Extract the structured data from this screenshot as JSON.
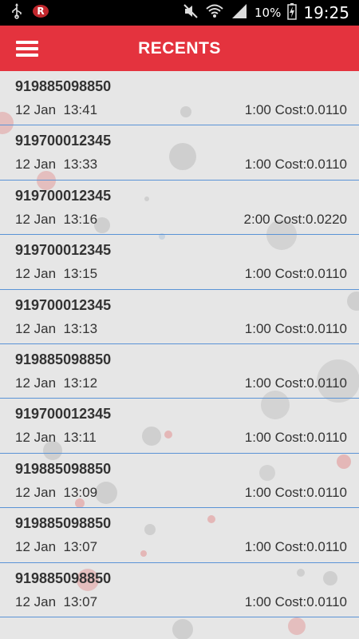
{
  "status": {
    "time": "19:25",
    "battery_percent": "10%",
    "icons": [
      "usb-icon",
      "app-notification-icon",
      "mute-icon",
      "wifi-icon",
      "signal-icon",
      "battery-charging-icon"
    ]
  },
  "header": {
    "title": "RECENTS",
    "menu_icon": "hamburger-menu-icon"
  },
  "calls": [
    {
      "number": "919885098850",
      "datetime": "12 Jan  13:41",
      "cost": "1:00 Cost:0.0110"
    },
    {
      "number": "919700012345",
      "datetime": "12 Jan  13:33",
      "cost": "1:00 Cost:0.0110"
    },
    {
      "number": "919700012345",
      "datetime": "12 Jan  13:16",
      "cost": "2:00 Cost:0.0220"
    },
    {
      "number": "919700012345",
      "datetime": "12 Jan  13:15",
      "cost": "1:00 Cost:0.0110"
    },
    {
      "number": "919700012345",
      "datetime": "12 Jan  13:13",
      "cost": "1:00 Cost:0.0110"
    },
    {
      "number": "919885098850",
      "datetime": "12 Jan  13:12",
      "cost": "1:00 Cost:0.0110"
    },
    {
      "number": "919700012345",
      "datetime": "12 Jan  13:11",
      "cost": "1:00 Cost:0.0110"
    },
    {
      "number": "919885098850",
      "datetime": "12 Jan  13:09",
      "cost": "1:00 Cost:0.0110"
    },
    {
      "number": "919885098850",
      "datetime": "12 Jan  13:07",
      "cost": "1:00 Cost:0.0110"
    },
    {
      "number": "919885098850",
      "datetime": "12 Jan  13:07",
      "cost": "1:00 Cost:0.0110"
    }
  ],
  "colors": {
    "accent": "#e4333e",
    "divider": "#5a93d6",
    "background": "#e6e6e6"
  }
}
